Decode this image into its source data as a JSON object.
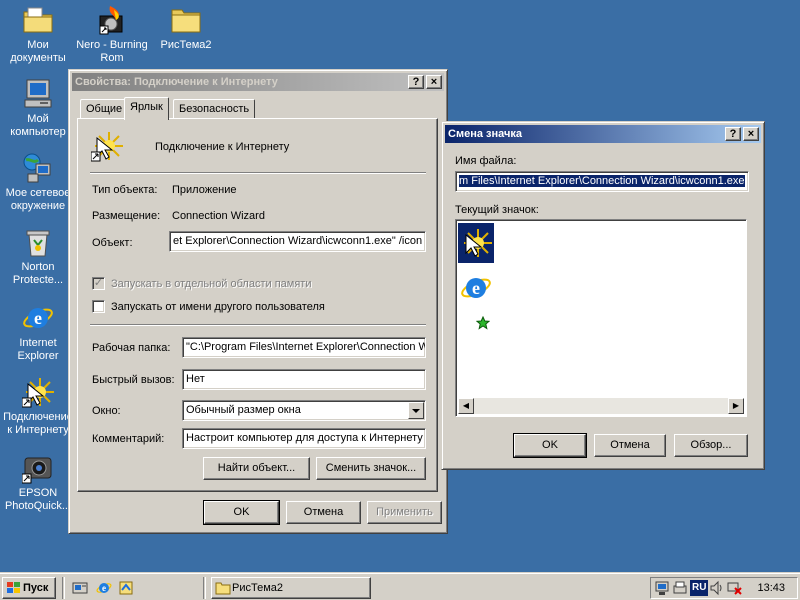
{
  "desktop": {
    "icons": [
      {
        "label": "Мои\nдокументы",
        "icon": "folder-documents-icon"
      },
      {
        "label": "Nero - Burning\nRom",
        "icon": "nero-icon"
      },
      {
        "label": "РисТема2",
        "icon": "folder-icon"
      },
      {
        "label": "Мой\nкомпьютер",
        "icon": "computer-icon"
      },
      {
        "label": "Мое сетевое\nокружение",
        "icon": "network-icon"
      },
      {
        "label": "Norton\nProtecte...",
        "icon": "recycle-bin-icon"
      },
      {
        "label": "Internet\nExplorer",
        "icon": "ie-icon"
      },
      {
        "label": "Подключение\nк Интернету",
        "icon": "connection-wizard-icon"
      },
      {
        "label": "EPSON\nPhotoQuick...",
        "icon": "epson-icon"
      }
    ]
  },
  "props": {
    "title": "Свойства: Подключение к Интернету",
    "title_buttons": {
      "help": "?",
      "close": "×"
    },
    "tabs": [
      "Общие",
      "Ярлык",
      "Безопасность"
    ],
    "active_tab": "Ярлык",
    "shortcut_name": "Подключение к Интернету",
    "type_label": "Тип объекта:",
    "type_value": "Приложение",
    "location_label": "Размещение:",
    "location_value": "Connection Wizard",
    "target_label": "Объект:",
    "target_value": "et Explorer\\Connection Wizard\\icwconn1.exe\" /icon",
    "separate_memory_label": "Запускать в отдельной области памяти",
    "separate_memory_checked": true,
    "run_as_label": "Запускать от имени другого пользователя",
    "run_as_checked": false,
    "workdir_label": "Рабочая папка:",
    "workdir_value": "\"C:\\Program Files\\Internet Explorer\\Connection W",
    "hotkey_label": "Быстрый вызов:",
    "hotkey_value": "Нет",
    "window_label": "Окно:",
    "window_value": "Обычный размер окна",
    "comment_label": "Комментарий:",
    "comment_value": "Настроит компьютер для доступа к Интернету",
    "find_target_label": "Найти объект...",
    "change_icon_label": "Сменить значок...",
    "ok_label": "OK",
    "cancel_label": "Отмена",
    "apply_label": "Применить"
  },
  "change_icon": {
    "title": "Смена значка",
    "title_buttons": {
      "help": "?",
      "close": "×"
    },
    "filename_label": "Имя файла:",
    "filename_value": "m Files\\Internet Explorer\\Connection Wizard\\icwconn1.exe",
    "current_icon_label": "Текущий значок:",
    "icons": [
      "connection-wizard-icon",
      "ie-icon",
      "green-star-icon"
    ],
    "selected_icon_index": 0,
    "ok_label": "OK",
    "cancel_label": "Отмена",
    "browse_label": "Обзор..."
  },
  "taskbar": {
    "start_label": "Пуск",
    "quick_launch": [
      "show-desktop-icon",
      "ie-icon",
      "outlook-express-icon"
    ],
    "tasks": [
      {
        "label": "РисТема2",
        "icon": "folder-icon"
      }
    ],
    "tray_icons": [
      "network-tray-icon",
      "printer-tray-icon",
      "language-indicator",
      "volume-icon",
      "disconnected-network-icon"
    ],
    "language": "RU",
    "clock": "13:43"
  },
  "colors": {
    "desktop": "#3a6ea5",
    "active_title": "#0a246a",
    "inactive_title": "#808080",
    "face": "#d4d0c8",
    "selection": "#0a246a"
  }
}
